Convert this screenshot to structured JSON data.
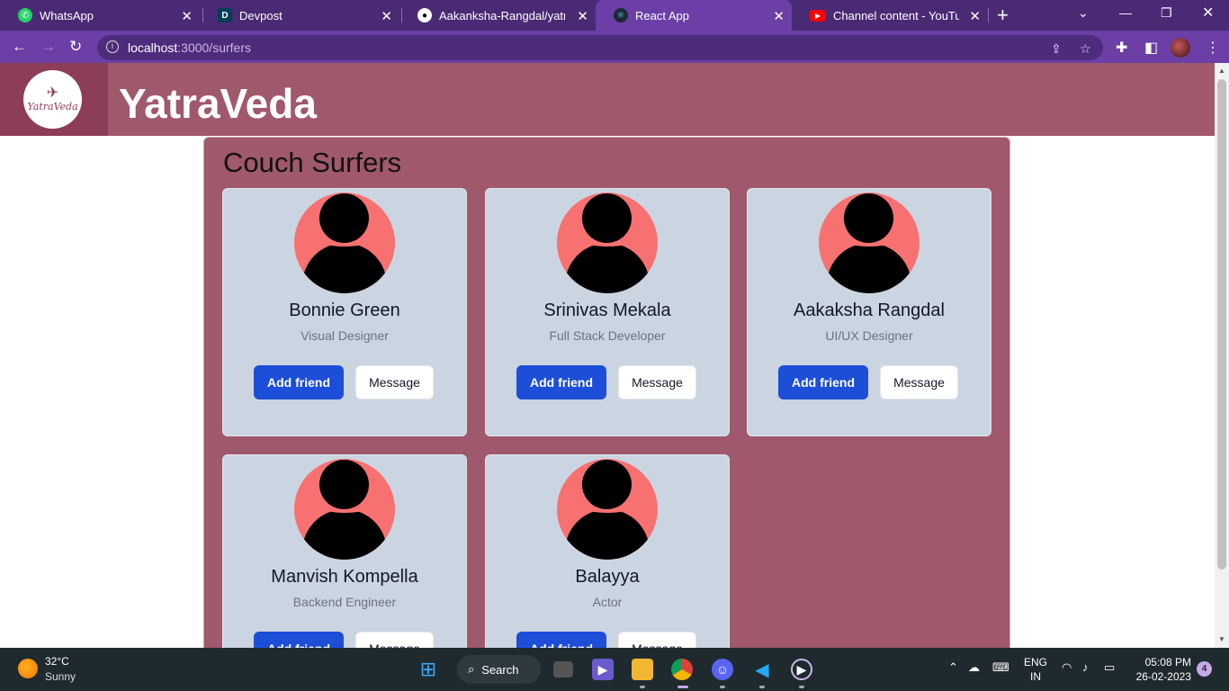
{
  "browser": {
    "tabs": [
      {
        "title": "WhatsApp",
        "icon": "whatsapp-icon",
        "color": "#25d366",
        "active": false
      },
      {
        "title": "Devpost",
        "icon": "devpost-icon",
        "color": "#003e54",
        "active": false
      },
      {
        "title": "Aakanksha-Rangdal/yatra-ve",
        "icon": "github-icon",
        "color": "#ffffff",
        "active": false
      },
      {
        "title": "React App",
        "icon": "react-icon",
        "color": "#61dafb",
        "active": true
      },
      {
        "title": "Channel content - YouTube S",
        "icon": "youtube-icon",
        "color": "#ff0000",
        "active": false
      }
    ],
    "address": {
      "host": "localhost",
      "path": ":3000/surfers"
    }
  },
  "site": {
    "title": "YatraVeda",
    "logo_text": "YatraVeda"
  },
  "page": {
    "heading": "Couch Surfers",
    "add_label": "Add friend",
    "message_label": "Message",
    "surfers": [
      {
        "name": "Bonnie Green",
        "role": "Visual Designer"
      },
      {
        "name": "Srinivas Mekala",
        "role": "Full Stack Developer"
      },
      {
        "name": "Aakaksha Rangdal",
        "role": "UI/UX Designer"
      },
      {
        "name": "Manvish Kompella",
        "role": "Backend Engineer"
      },
      {
        "name": "Balayya",
        "role": "Actor"
      }
    ]
  },
  "taskbar": {
    "temp": "32°C",
    "weather": "Sunny",
    "search_label": "Search",
    "lang_top": "ENG",
    "lang_bottom": "IN",
    "time": "05:08 PM",
    "date": "26-02-2023",
    "notifications": "4"
  },
  "colors": {
    "brand": "#a0586c",
    "primary_button": "#1d4ed8",
    "avatar_bg": "#f87171",
    "card_bg": "#cbd5e1"
  }
}
